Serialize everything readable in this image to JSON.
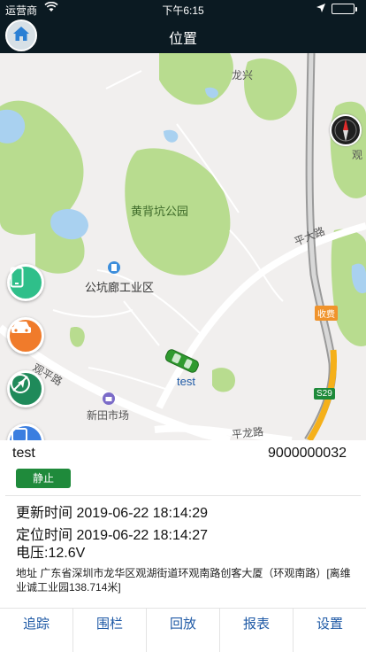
{
  "status_bar": {
    "carrier": "运营商",
    "time": "下午6:15"
  },
  "nav": {
    "title": "位置"
  },
  "map": {
    "labels": {
      "longxing": "龙兴",
      "huangbeikeng": "黄背坑公园",
      "gongkenglang": "公坑廊工业区",
      "pingdalu": "平大路",
      "guanpinglu": "观平路",
      "xintian": "新田市场",
      "pinglonglu": "平龙路",
      "guan": "观",
      "toll": "收费",
      "s29": "S29",
      "vehicle": "test"
    }
  },
  "device": {
    "name": "test",
    "id": "9000000032",
    "status": "静止",
    "update_time_label": "更新时间",
    "update_time": "2019-06-22 18:14:29",
    "locate_time_label": "定位时间",
    "locate_time": "2019-06-22 18:14:27",
    "voltage_label": "电压:",
    "voltage": "12.6V",
    "address": "地址 广东省深圳市龙华区观湖街道环观南路创客大厦（环观南路）[离维业诚工业园138.714米]"
  },
  "tabs": [
    "追踪",
    "围栏",
    "回放",
    "报表",
    "设置"
  ],
  "colors": {
    "topbar": "#0b1a22",
    "accent": "#1f5aa6",
    "status_green": "#1f8a3b",
    "park": "#b8dc8f",
    "water": "#a9d1f0"
  }
}
